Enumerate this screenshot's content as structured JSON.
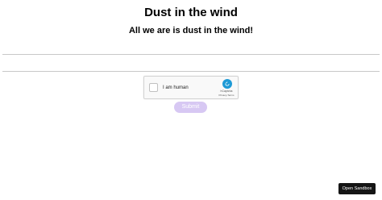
{
  "header": {
    "title": "Dust in the wind",
    "subtitle": "All we are is dust in the wind!"
  },
  "captcha": {
    "label": "I am human",
    "brand": "hCaptcha",
    "privacy_link": "Privacy",
    "separator": " - ",
    "terms_link": "Terms",
    "checked": false,
    "logo_icon": "hcaptcha-logo-icon",
    "logo_color": "#1e9ad6"
  },
  "form": {
    "submit_label": "Submit",
    "submit_color": "#d7c8f3"
  },
  "sandbox": {
    "open_label": "Open Sandbox"
  }
}
